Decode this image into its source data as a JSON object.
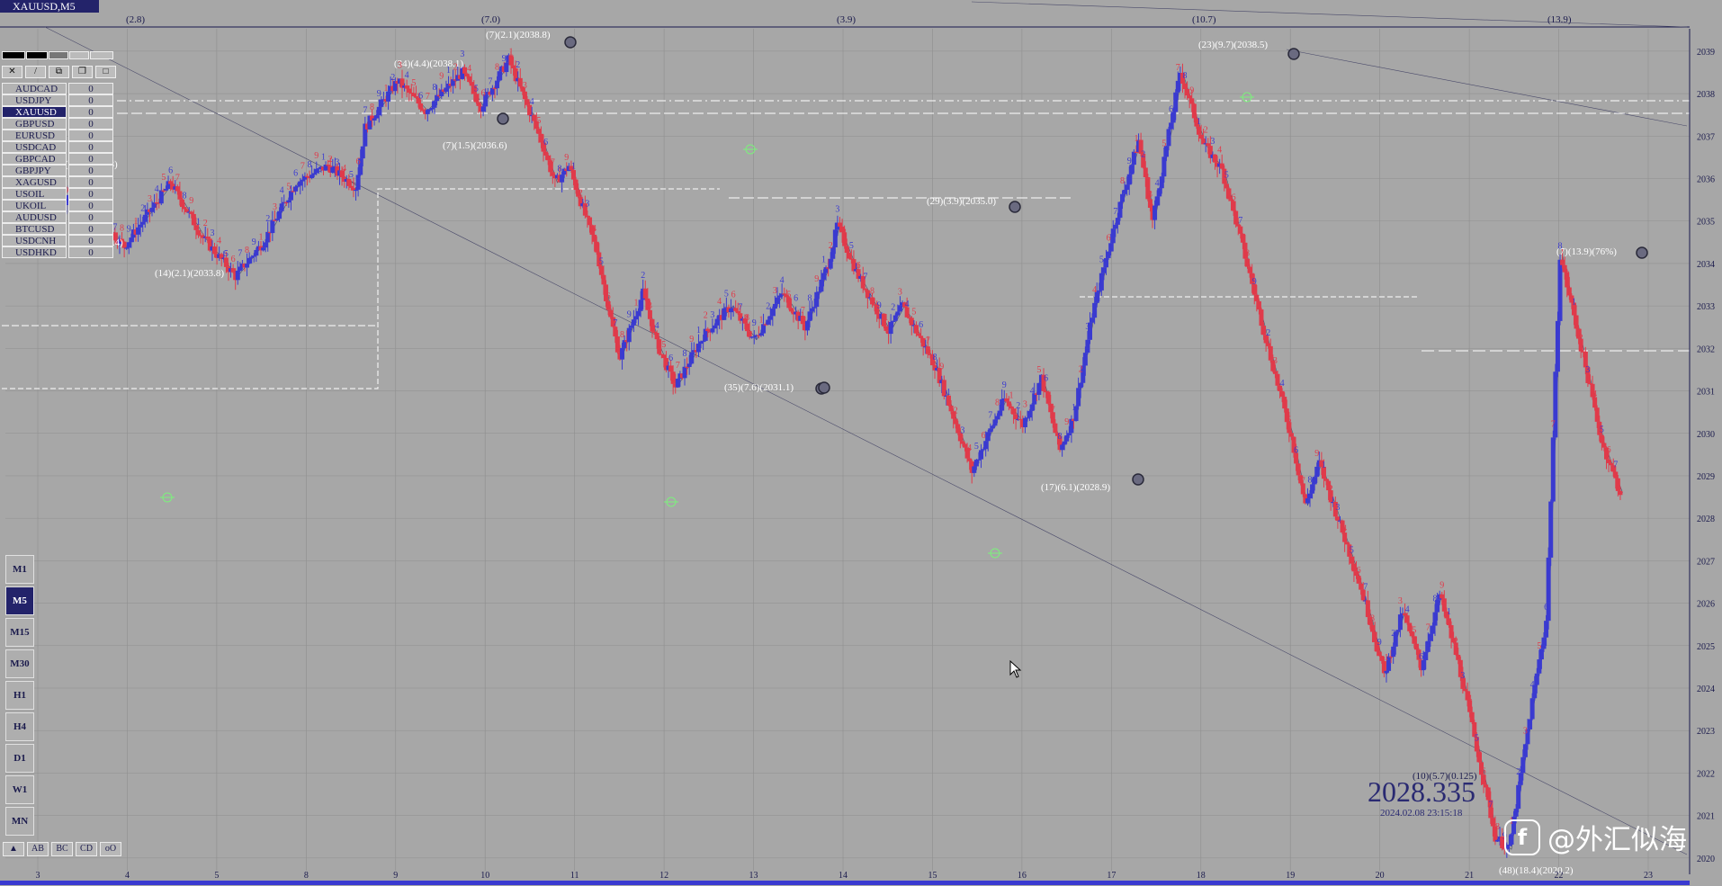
{
  "window": {
    "title": "XAUUSD,M5"
  },
  "symbols": [
    {
      "name": "AUDCAD",
      "value": "0"
    },
    {
      "name": "USDJPY",
      "value": "0"
    },
    {
      "name": "XAUUSD",
      "value": "0",
      "active": true
    },
    {
      "name": "GBPUSD",
      "value": "0"
    },
    {
      "name": "EURUSD",
      "value": "0"
    },
    {
      "name": "USDCAD",
      "value": "0"
    },
    {
      "name": "GBPCAD",
      "value": "0"
    },
    {
      "name": "GBPJPY",
      "value": "0"
    },
    {
      "name": "XAGUSD",
      "value": "0"
    },
    {
      "name": "USOIL",
      "value": "0"
    },
    {
      "name": "UKOIL",
      "value": "0"
    },
    {
      "name": "AUDUSD",
      "value": "0"
    },
    {
      "name": "BTCUSD",
      "value": "0"
    },
    {
      "name": "USDCNH",
      "value": "0"
    },
    {
      "name": "USDHKD",
      "value": "0"
    }
  ],
  "timeframes": [
    "M1",
    "M5",
    "M15",
    "M30",
    "H1",
    "H4",
    "D1",
    "W1",
    "MN"
  ],
  "active_timeframe": "M5",
  "tools": [
    "▲",
    "AB",
    "BC",
    "CD",
    "oO"
  ],
  "price": {
    "current": "2028.335",
    "timestamp": "2024.02.08  23:15:18",
    "meta": "(10)(5.7)(0.125)"
  },
  "watermark": {
    "text": "@外汇似海"
  },
  "colors": {
    "up": "#3a3ad0",
    "down": "#e03a4a",
    "bg": "#a7a7a7",
    "axis": "#1a1a4c",
    "label_yellow": "#f5f500",
    "label_green": "#7cf07c"
  },
  "chart_data": {
    "type": "candlestick",
    "ylim": [
      2019.7,
      2039.4
    ],
    "y_ticks": [
      2020,
      2021,
      2022,
      2023,
      2024,
      2025,
      2026,
      2027,
      2028,
      2029,
      2030,
      2031,
      2032,
      2033,
      2034,
      2035,
      2036,
      2037,
      2038,
      2039
    ],
    "x_ticks": [
      "3",
      "4",
      "5",
      "8",
      "9",
      "10",
      "11",
      "12",
      "13",
      "14",
      "15",
      "16",
      "17",
      "18",
      "19",
      "20",
      "21",
      "22",
      "23"
    ],
    "session_marks": [
      "(2.8)",
      "(7.0)",
      "(3.9)",
      "(10.7)",
      "(13.9)"
    ],
    "swing_labels": [
      {
        "text": "(7)(2.1)(2038.8)",
        "price": 2038.8
      },
      {
        "text": "(34)(4.4)(2038.1)",
        "price": 2038.1
      },
      {
        "text": "(7)(1.5)(2036.6)",
        "price": 2036.6
      },
      {
        "text": "(1.4)(2035.8)",
        "price": 2035.8
      },
      {
        "text": "(14)(2.1)(2033.8)",
        "price": 2033.8
      },
      {
        "text": "(1.3)(2034.4)",
        "price": 2034.4
      },
      {
        "text": "(35)(7.6)(2031.1)",
        "price": 2031.1
      },
      {
        "text": "(29)(3.9)(2035.0)",
        "price": 2035.0
      },
      {
        "text": "(17)(6.1)(2028.9)",
        "price": 2028.9
      },
      {
        "text": "(23)(9.7)(2038.5)",
        "price": 2038.5
      },
      {
        "text": "(7)(13.9)(76%)",
        "price": 2034.2
      },
      {
        "text": "(48)(18.4)(2020.2)",
        "price": 2020.2
      }
    ],
    "path": [
      [
        2034.8,
        20
      ],
      [
        2035.6,
        30
      ],
      [
        2034.4,
        20
      ],
      [
        2035.9,
        20
      ],
      [
        2034.6,
        14
      ],
      [
        2033.7,
        14
      ],
      [
        2034.5,
        12
      ],
      [
        2035.9,
        14
      ],
      [
        2036.3,
        14
      ],
      [
        2035.8,
        12
      ],
      [
        2037.2,
        4
      ],
      [
        2038.3,
        14
      ],
      [
        2037.6,
        12
      ],
      [
        2038.5,
        16
      ],
      [
        2037.7,
        8
      ],
      [
        2038.8,
        12
      ],
      [
        2036.9,
        14
      ],
      [
        2035.9,
        6
      ],
      [
        2036.3,
        6
      ],
      [
        2034.3,
        12
      ],
      [
        2032.7,
        6
      ],
      [
        2031.8,
        4
      ],
      [
        2033.3,
        10
      ],
      [
        2032.1,
        6
      ],
      [
        2031.1,
        8
      ],
      [
        2032.3,
        12
      ],
      [
        2033.0,
        12
      ],
      [
        2032.2,
        10
      ],
      [
        2033.3,
        12
      ],
      [
        2032.5,
        10
      ],
      [
        2034.0,
        10
      ],
      [
        2034.9,
        4
      ],
      [
        2033.8,
        8
      ],
      [
        2032.4,
        14
      ],
      [
        2033.0,
        6
      ],
      [
        2031.6,
        14
      ],
      [
        2030.4,
        8
      ],
      [
        2029.1,
        8
      ],
      [
        2029.6,
        4
      ],
      [
        2030.8,
        10
      ],
      [
        2030.2,
        8
      ],
      [
        2031.3,
        8
      ],
      [
        2029.6,
        8
      ],
      [
        2030.4,
        6
      ],
      [
        2032.8,
        8
      ],
      [
        2035.0,
        10
      ],
      [
        2036.9,
        10
      ],
      [
        2035.0,
        6
      ],
      [
        2038.5,
        12
      ],
      [
        2036.8,
        10
      ],
      [
        2036.2,
        8
      ],
      [
        2034.6,
        8
      ],
      [
        2032.0,
        12
      ],
      [
        2029.9,
        10
      ],
      [
        2028.3,
        6
      ],
      [
        2029.3,
        6
      ],
      [
        2028.0,
        8
      ],
      [
        2026.7,
        8
      ],
      [
        2025.6,
        6
      ],
      [
        2024.3,
        6
      ],
      [
        2025.8,
        8
      ],
      [
        2024.5,
        8
      ],
      [
        2026.2,
        8
      ],
      [
        2024.6,
        8
      ],
      [
        2022.6,
        8
      ],
      [
        2020.5,
        8
      ],
      [
        2020.2,
        6
      ],
      [
        2022.3,
        6
      ],
      [
        2023.7,
        4
      ],
      [
        2025.6,
        6
      ],
      [
        2034.2,
        6
      ],
      [
        2031.8,
        10
      ],
      [
        2029.8,
        8
      ],
      [
        2028.6,
        8
      ]
    ]
  }
}
